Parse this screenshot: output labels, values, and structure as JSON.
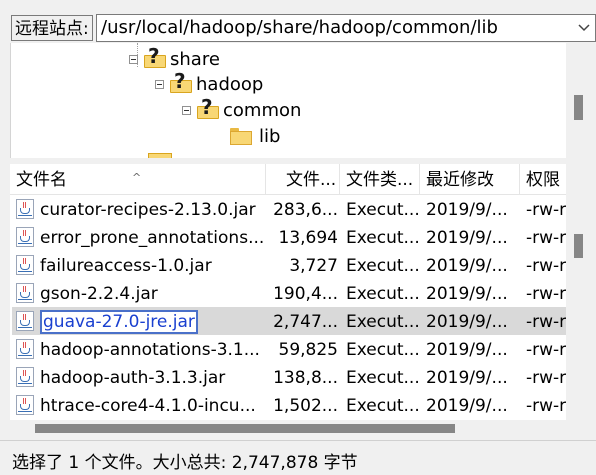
{
  "remote_site": {
    "label": "远程站点:",
    "path": "/usr/local/hadoop/share/hadoop/common/lib"
  },
  "tree": {
    "nodes": [
      {
        "label": "share",
        "icon": "question-folder-icon"
      },
      {
        "label": "hadoop",
        "icon": "question-folder-icon"
      },
      {
        "label": "common",
        "icon": "question-folder-icon"
      },
      {
        "label": "lib",
        "icon": "folder-icon"
      }
    ]
  },
  "file_list": {
    "columns": {
      "name": "文件名",
      "size": "文件...",
      "type": "文件类...",
      "modified": "最近修改",
      "perm": "权限"
    },
    "sort_indicator": "^",
    "rows": [
      {
        "name": "curator-recipes-2.13.0.jar",
        "size": "283,6...",
        "type": "Execut...",
        "modified": "2019/9/...",
        "perm": "-rw-r"
      },
      {
        "name": "error_prone_annotations...",
        "size": "13,694",
        "type": "Execut...",
        "modified": "2019/9/...",
        "perm": "-rw-r"
      },
      {
        "name": "failureaccess-1.0.jar",
        "size": "3,727",
        "type": "Execut...",
        "modified": "2019/9/...",
        "perm": "-rw-r"
      },
      {
        "name": "gson-2.2.4.jar",
        "size": "190,4...",
        "type": "Execut...",
        "modified": "2019/9/...",
        "perm": "-rw-r"
      },
      {
        "name": "guava-27.0-jre.jar",
        "size": "2,747...",
        "type": "Execut...",
        "modified": "2019/9/...",
        "perm": "-rw-r",
        "selected": true
      },
      {
        "name": "hadoop-annotations-3.1...",
        "size": "59,825",
        "type": "Execut...",
        "modified": "2019/9/...",
        "perm": "-rw-r"
      },
      {
        "name": "hadoop-auth-3.1.3.jar",
        "size": "138,8...",
        "type": "Execut...",
        "modified": "2019/9/...",
        "perm": "-rw-r"
      },
      {
        "name": "htrace-core4-4.1.0-incu...",
        "size": "1,502...",
        "type": "Execut...",
        "modified": "2019/9/...",
        "perm": "-rw-r"
      }
    ]
  },
  "status": {
    "text": "选择了 1 个文件。大小总共: 2,747,878 字节"
  }
}
